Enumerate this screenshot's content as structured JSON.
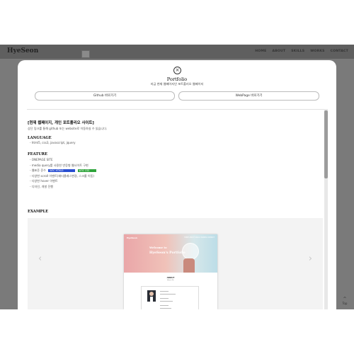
{
  "navbar": {
    "brand": "HyeSeon",
    "links": [
      "HOME",
      "ABOUT",
      "SKILLS",
      "WORKS",
      "CONTACT"
    ]
  },
  "top_button": {
    "icon": "arrow-up-icon",
    "label": "Top"
  },
  "modal": {
    "close_icon": "close-icon",
    "title": "Portfolio",
    "subtitle": "지금 현재 웹페이지인 포트폴리오 웹페이지",
    "buttons": {
      "github": "Github 바로가기",
      "webpage": "WebPage 바로가기"
    },
    "heading": "[현재 웹페이지, 개인 포트폴리오 사이트]",
    "intro": "상단 링크를 통해 github 또는 website로 이동하실 수 있습니다.",
    "language": {
      "title": "LANGUAGE",
      "items": [
        "- html5, css3, javascript, jquery"
      ]
    },
    "feature": {
      "title": "FEATURE",
      "items": [
        "- ONEPAGE SITE",
        "- media query를 사용한 반응형 웹사이트 구현",
        "- 웹표준 준수",
        "- 다양한 scroll 이벤트(헤더클래스변경, 스크롤 이동)",
        "- 다양한 hover 이벤트",
        "- 디자인, 개발 진행"
      ],
      "badges": [
        "W3C HTML5",
        "W3C CSS"
      ]
    },
    "example": {
      "title": "EXAMPLE",
      "prev_icon": "chevron-left-icon",
      "next_icon": "chevron-right-icon",
      "preview": {
        "brand": "HyeSeon",
        "nav": "HOME ABOUT SKILLS WORKS CONTACT",
        "welcome": "Welcome to",
        "name": "HyeSeon's Portfolio",
        "about_title": "ABOUT",
        "about_sub": "About Me"
      }
    }
  },
  "colors": {
    "overlay": "#7a7a7a",
    "navbar": "#5f5f5f",
    "badge_blue": "#2a4fd1",
    "badge_green": "#2fa43b",
    "hero_pink": "#eaa6a8",
    "hero_blue": "#bcdde7"
  }
}
